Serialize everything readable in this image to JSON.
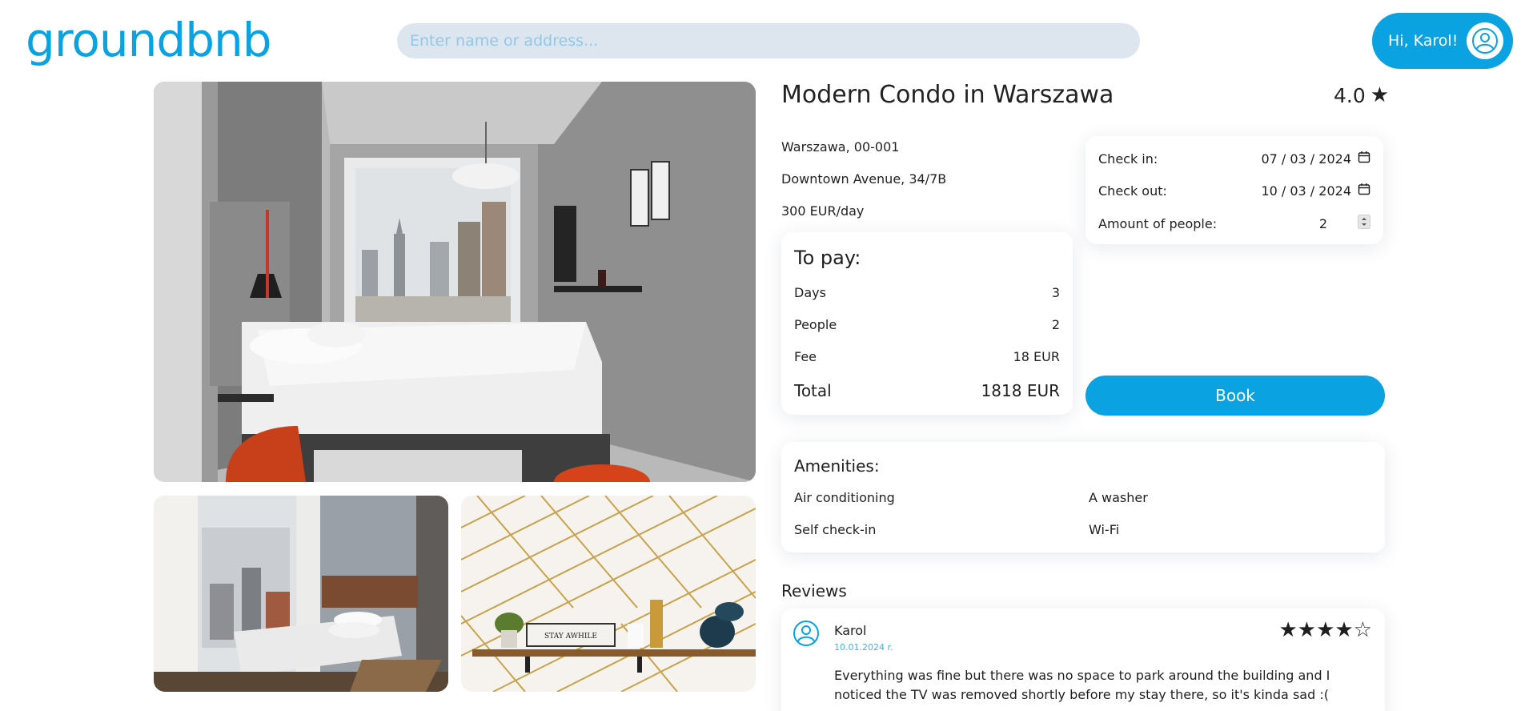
{
  "header": {
    "logo": "groundbnb",
    "search_placeholder": "Enter name or address...",
    "greeting": "Hi, Karol!",
    "avatar_icon": "user-icon"
  },
  "listing": {
    "title": "Modern Condo in Warszawa",
    "rating": "4.0",
    "rating_icon": "star-icon",
    "city": "Warszawa, 00-001",
    "street": "Downtown Avenue, 34/7B",
    "price": "300 EUR/day"
  },
  "booking": {
    "check_in_label": "Check in:",
    "check_in_value": "07 / 03 / 2024",
    "check_out_label": "Check out:",
    "check_out_value": "10 / 03 / 2024",
    "people_label": "Amount of people:",
    "people_value": "2",
    "book_label": "Book"
  },
  "payment": {
    "heading": "To pay:",
    "rows": [
      {
        "label": "Days",
        "value": "3"
      },
      {
        "label": "People",
        "value": "2"
      },
      {
        "label": "Fee",
        "value": "18 EUR"
      }
    ],
    "total_label": "Total",
    "total_value": "1818 EUR"
  },
  "amenities": {
    "heading": "Amenities:",
    "items": [
      "Air conditioning",
      "A washer",
      "Self check-in",
      "Wi-Fi"
    ]
  },
  "reviews": {
    "heading": "Reviews",
    "items": [
      {
        "name": "Karol",
        "date": "10.01.2024 r.",
        "stars": "★★★★☆",
        "rating": 4,
        "text": "Everything was fine but there was no space to park around the building and I noticed the TV was removed shortly before my stay there, so it's kinda sad :("
      }
    ]
  },
  "photos": {
    "main_sign": "STAY AWHILE"
  },
  "colors": {
    "accent": "#0aa2e0",
    "search_bg": "#dde6ef"
  }
}
